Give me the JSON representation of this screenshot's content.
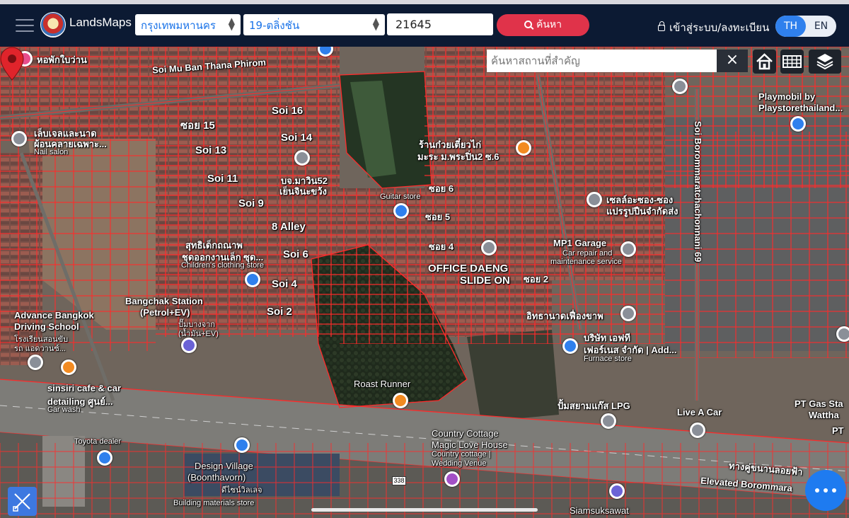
{
  "header": {
    "brand": "LandsMaps",
    "province_select": "กรุงเทพมหานคร",
    "district_select": "19-ตลิ่งชัน",
    "parcel_number": "21645",
    "search_label": "ค้นหา",
    "login_label": "เข้าสู่ระบบ/ลงทะเบียน",
    "lang_th": "TH",
    "lang_en": "EN"
  },
  "map": {
    "place_search_placeholder": "ค้นหาสถานที่สำคัญ",
    "clear_label": "×",
    "road_shield": "338",
    "labels": [
      "หอพักใบว่าน",
      "Soi Mu Ban Thana Phirom",
      "Soi 16",
      "ซอย 15",
      "Soi 14",
      "Soi 13",
      "Soi 11",
      "Soi 9",
      "8 Alley",
      "Soi 6",
      "Soi 4",
      "Soi 2",
      "เล็บเจลและนาด",
      "ผ้อนคลายเฉพาะ...",
      "Nail salon",
      "บจ.มาวิน52",
      "เย็นจินะขว้ง",
      "Guitar store",
      "ร้านก๋วยเตี๋ยวไก่",
      "มะระ ม.พระปิ่น2 ซ.6",
      "ซอย 6",
      "ซอย 5",
      "ซอย 4",
      "ซอย 2",
      "สุทธิเด็กถณาพ",
      "ชุดออกงานเล็ก ซุด...",
      "Children's clothing store",
      "Bangchak Station",
      "(Petrol+EV)",
      "ปั๊มบางจาก",
      "(น้ำมัน+EV)",
      "Advance Bangkok",
      "Driving School",
      "โรงเรียนสอนขับ",
      "รถ แอดวานซ์...",
      "OFFICE DAENG",
      "SLIDE ON",
      "MP1 Garage",
      "Car repair and",
      "maintenance service",
      "อิทธานาดเฟื่องขาพ",
      "เซลล์อะซอง-ซอง",
      "แปรรูปปืนจำกัดส่ง",
      "Soi Borommaratchachonnani 69",
      "Playmobil by",
      "Playstorethailand...",
      "บริษัท เอฟที",
      "เฟอร์เนส จำกัด | Add...",
      "Furnace store",
      "sinsiri cafe & car",
      "detailing ศูนย์...",
      "Car wash",
      "Roast Runner",
      "ปั้มสยามแก๊ส LPG",
      "Live A Car",
      "PT Gas Sta",
      "Wattha",
      "PT",
      "Country Cottage",
      "Magic Love House",
      "Country cottage |",
      "Wedding Venue",
      "Toyota dealer",
      "Design Village",
      "(Boonthavorn)",
      "ดีไซน์วิลเลจ",
      "Building materials store",
      "ทางคู่ขนานลอยฟ้า",
      "Elevated Borommara",
      "Siamsuksawat"
    ]
  },
  "colors": {
    "header_bg": "#0c1a33",
    "accent_blue": "#2f80ed",
    "search_red": "#e0334a",
    "parcel_line": "#ff2a2a",
    "pin_red": "#e0242b"
  },
  "icons": [
    "hamburger-icon",
    "search-icon",
    "lock-icon",
    "home-icon",
    "grid-icon",
    "layers-icon",
    "close-icon",
    "map-pin-icon",
    "ruler-icon",
    "more-dots-icon"
  ]
}
